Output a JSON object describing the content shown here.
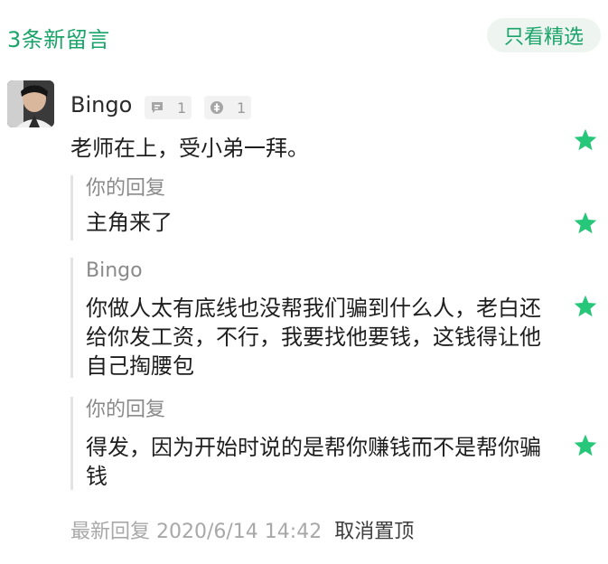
{
  "header": {
    "title": "3条新留言",
    "filter_label": "只看精选"
  },
  "comment": {
    "username": "Bingo",
    "reply_count": "1",
    "like_count": "1",
    "text": "老师在上，受小弟一拜。"
  },
  "replies": [
    {
      "author": "你的回复",
      "text": "主角来了"
    },
    {
      "author": "Bingo",
      "text": "你做人太有底线也没帮我们骗到什么人，老白还给你发工资，不行，我要找他要钱，这钱得让他自己掏腰包"
    },
    {
      "author": "你的回复",
      "text": "得发，因为开始时说的是帮你赚钱而不是帮你骗钱"
    }
  ],
  "footer": {
    "latest_reply": "最新回复 2020/6/14 14:42",
    "unpin_label": "取消置顶"
  },
  "colors": {
    "accent": "#1aa46a",
    "star": "#27c77a"
  }
}
